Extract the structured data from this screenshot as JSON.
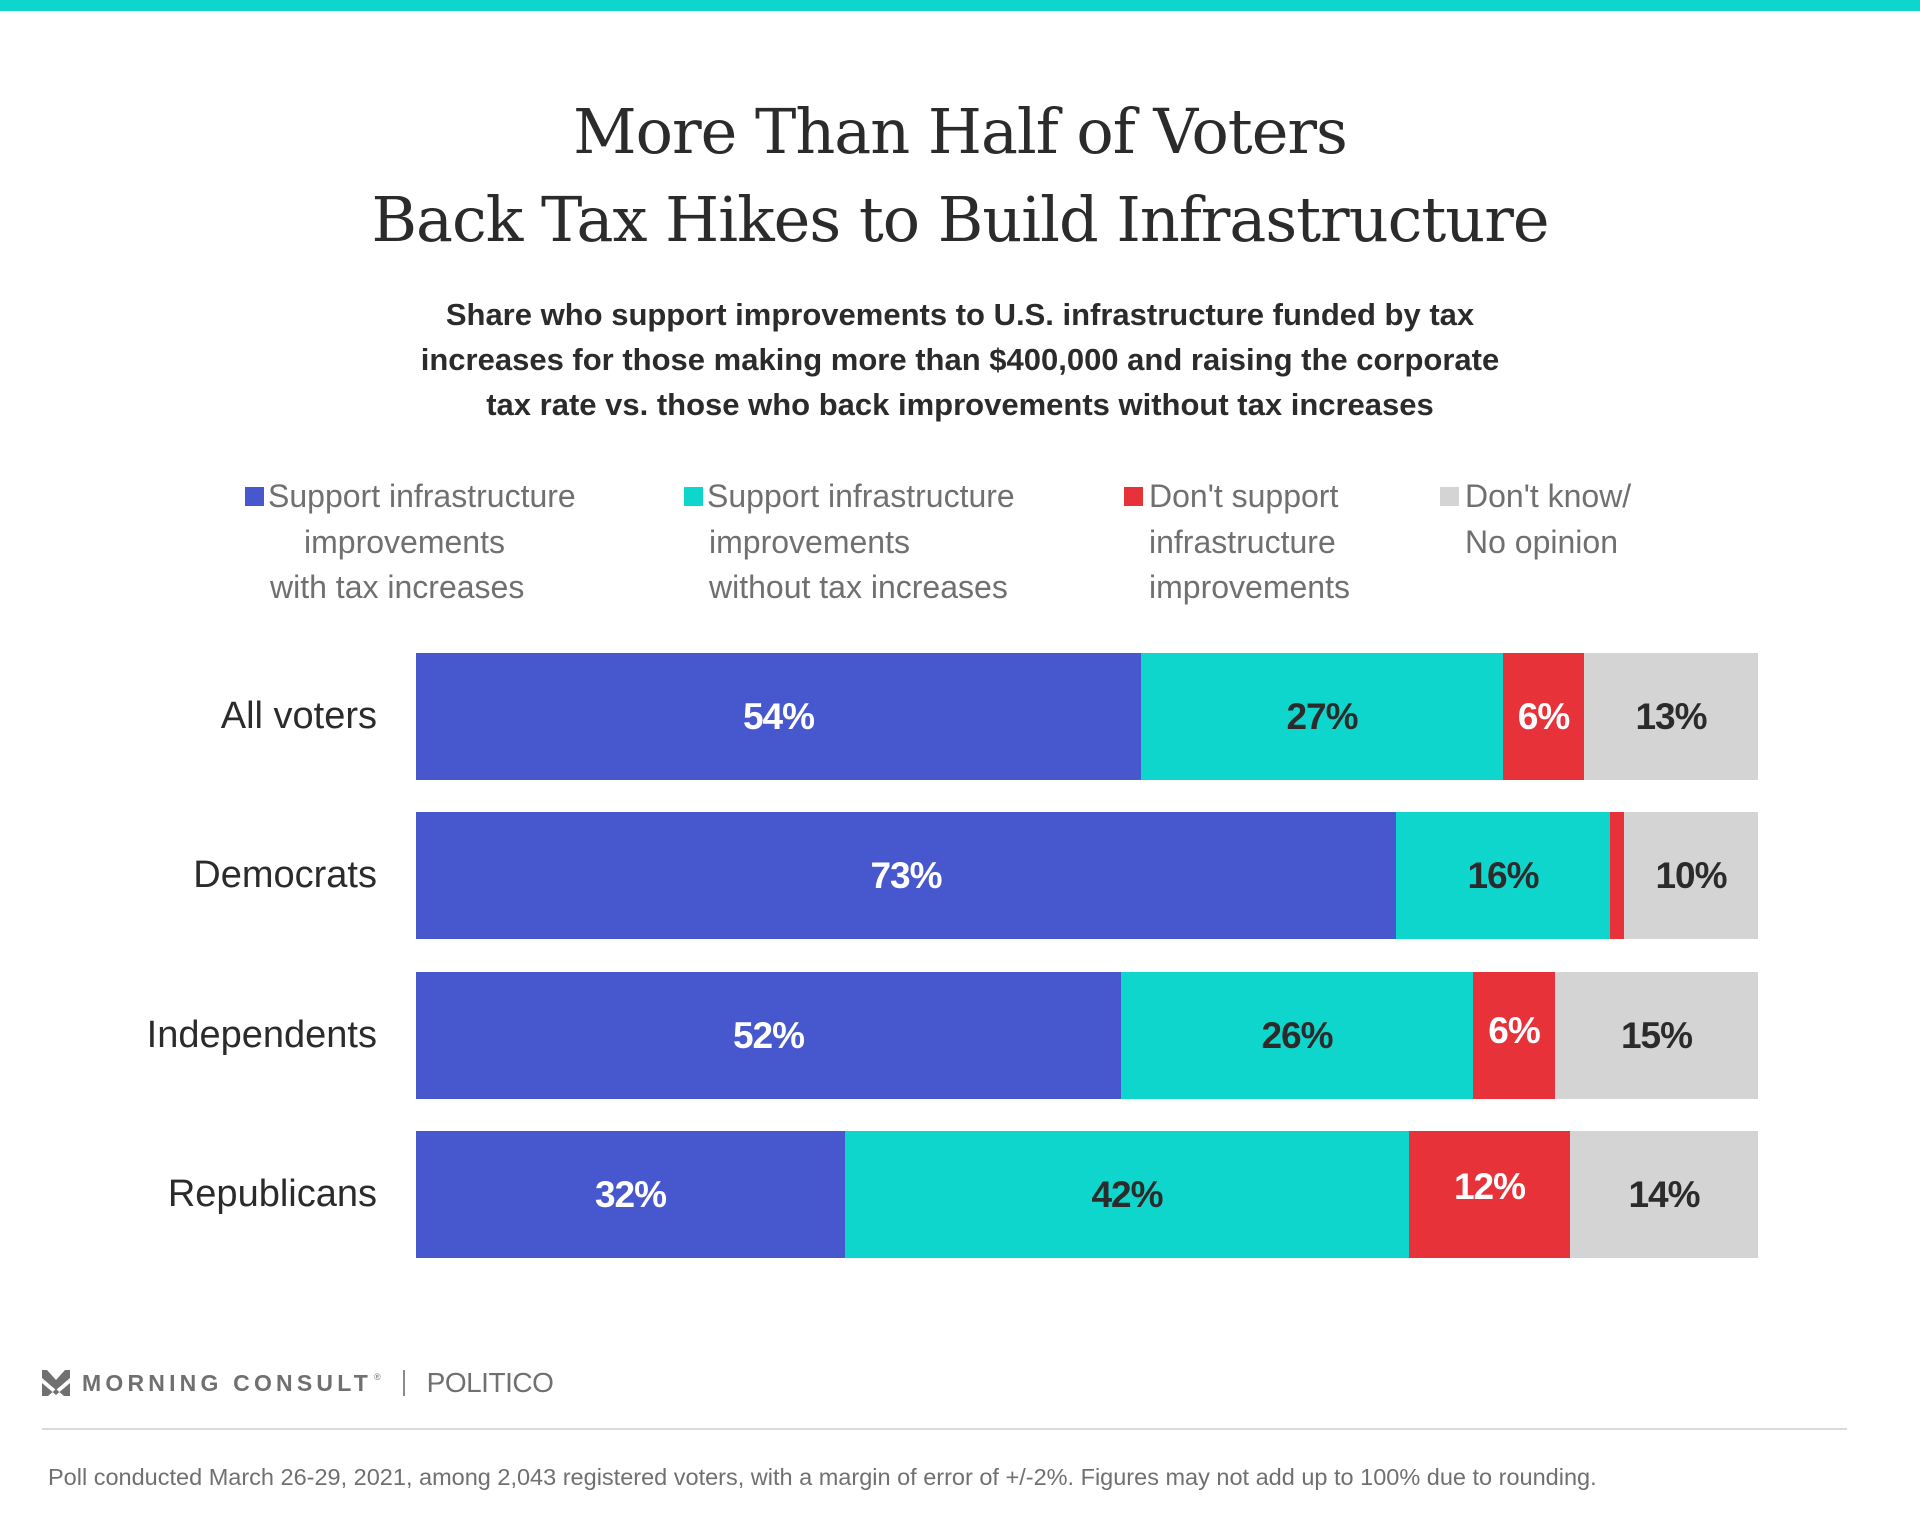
{
  "colors": {
    "accent_bar": "#0FD6CC",
    "with_tax": "#4758CF",
    "without_tax": "#0FD6CC",
    "dont_support": "#E8323A",
    "dont_know": "#D4D4D4",
    "title_text": "#2B2B2B",
    "muted_text": "#707070"
  },
  "title_lines": [
    "More Than Half of Voters",
    "Back Tax Hikes to Build Infrastructure"
  ],
  "subtitle_lines": [
    "Share who support improvements to U.S. infrastructure funded by tax",
    "increases for those making more than $400,000 and raising the corporate",
    "tax rate vs. those who back improvements without tax increases"
  ],
  "legend": [
    {
      "key": "with_tax",
      "lines": [
        "Support infrastructure",
        "improvements",
        "with tax increases"
      ]
    },
    {
      "key": "without_tax",
      "lines": [
        "Support infrastructure",
        "improvements",
        "without tax increases"
      ]
    },
    {
      "key": "dont_support",
      "lines": [
        "Don't support",
        "infrastructure",
        "improvements"
      ]
    },
    {
      "key": "dont_know",
      "lines": [
        "Don't know/",
        "No opinion"
      ]
    }
  ],
  "chart_data": {
    "type": "bar",
    "orientation": "horizontal",
    "stacked": true,
    "title": "More Than Half of Voters Back Tax Hikes to Build Infrastructure",
    "subtitle": "Share who support improvements to U.S. infrastructure funded by tax increases for those making more than $400,000 and raising the corporate tax rate vs. those who back improvements without tax increases",
    "xlabel": "",
    "ylabel": "",
    "xlim": [
      0,
      100
    ],
    "grid": false,
    "legend_position": "top",
    "categories": [
      "All voters",
      "Democrats",
      "Independents",
      "Republicans"
    ],
    "series": [
      {
        "name": "Support infrastructure improvements with tax increases",
        "key": "with_tax",
        "values": [
          54,
          73,
          52,
          32
        ],
        "labels": [
          "54%",
          "73%",
          "52%",
          "32%"
        ],
        "label_color": "#FFFFFF"
      },
      {
        "name": "Support infrastructure improvements without tax increases",
        "key": "without_tax",
        "values": [
          27,
          16,
          26,
          42
        ],
        "labels": [
          "27%",
          "16%",
          "26%",
          "42%"
        ],
        "label_color": "#2B2B2B"
      },
      {
        "name": "Don't support infrastructure improvements",
        "key": "dont_support",
        "values": [
          6,
          1,
          6,
          12
        ],
        "labels": [
          "6%",
          "",
          "6%",
          "12%"
        ],
        "label_color": "#FFFFFF"
      },
      {
        "name": "Don't know/No opinion",
        "key": "dont_know",
        "values": [
          13,
          10,
          15,
          14
        ],
        "labels": [
          "13%",
          "10%",
          "15%",
          "14%"
        ],
        "label_color": "#2B2B2B"
      }
    ]
  },
  "footer": {
    "brand_primary": "MORNING CONSULT",
    "brand_reg": "®",
    "brand_partner": "POLITICO",
    "note": "Poll conducted March 26-29, 2021, among 2,043 registered voters, with a margin of error of +/-2%. Figures may not add up to 100% due to rounding."
  }
}
